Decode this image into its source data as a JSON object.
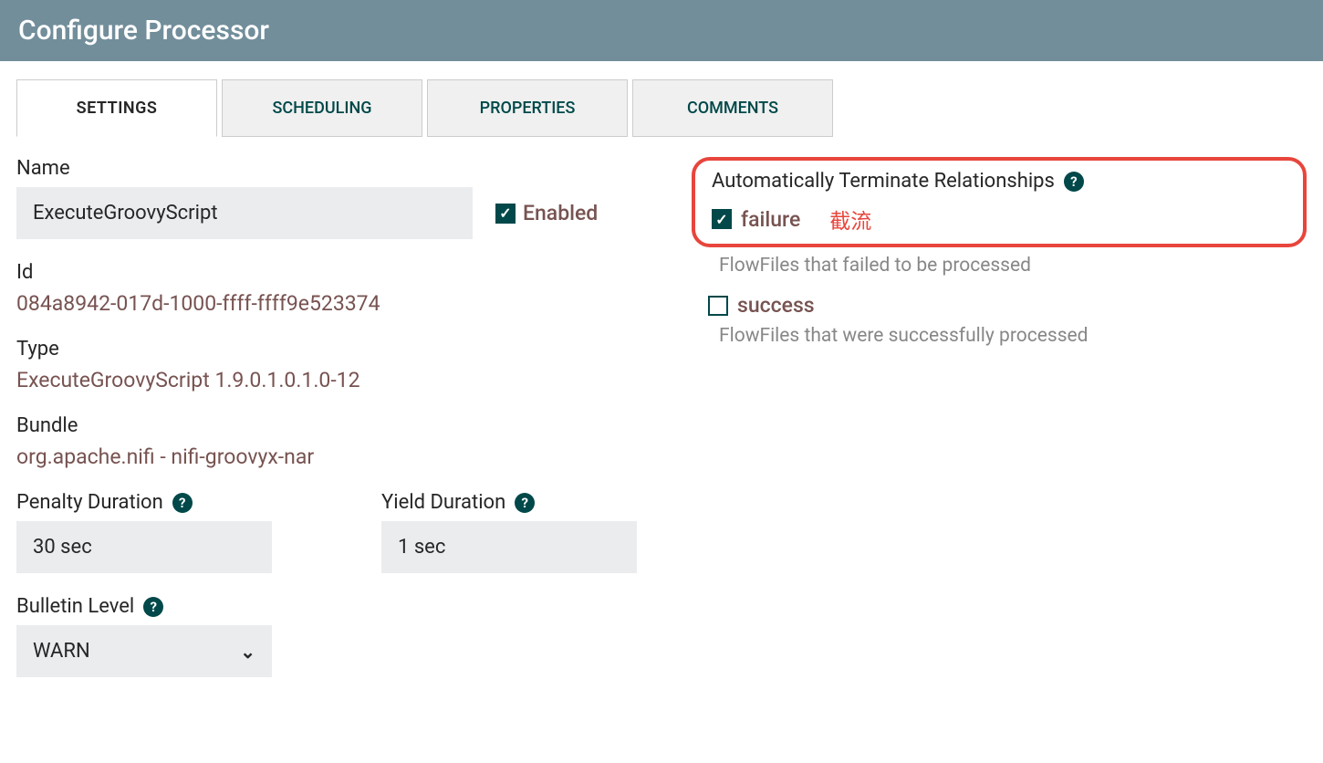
{
  "header": {
    "title": "Configure Processor"
  },
  "tabs": {
    "settings": "SETTINGS",
    "scheduling": "SCHEDULING",
    "properties": "PROPERTIES",
    "comments": "COMMENTS"
  },
  "settings": {
    "name_label": "Name",
    "name_value": "ExecuteGroovyScript",
    "enabled_label": "Enabled",
    "enabled_checked": true,
    "id_label": "Id",
    "id_value": "084a8942-017d-1000-ffff-ffff9e523374",
    "type_label": "Type",
    "type_value": "ExecuteGroovyScript 1.9.0.1.0.1.0-12",
    "bundle_label": "Bundle",
    "bundle_value": "org.apache.nifi - nifi-groovyx-nar",
    "penalty_label": "Penalty Duration",
    "penalty_value": "30 sec",
    "yield_label": "Yield Duration",
    "yield_value": "1 sec",
    "bulletin_label": "Bulletin Level",
    "bulletin_value": "WARN"
  },
  "relationships": {
    "header": "Automatically Terminate Relationships",
    "annotation": "截流",
    "items": [
      {
        "name": "failure",
        "checked": true,
        "desc": "FlowFiles that failed to be processed"
      },
      {
        "name": "success",
        "checked": false,
        "desc": "FlowFiles that were successfully processed"
      }
    ]
  }
}
